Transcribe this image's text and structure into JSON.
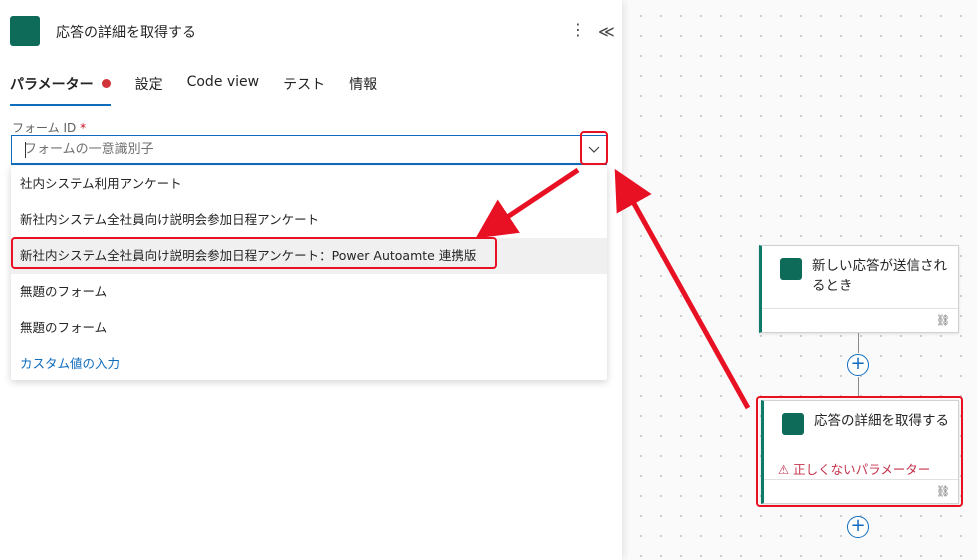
{
  "panel": {
    "title": "応答の詳細を取得する",
    "tabs": [
      {
        "label": "パラメーター",
        "active": true,
        "has_error": true
      },
      {
        "label": "設定"
      },
      {
        "label": "Code view"
      },
      {
        "label": "テスト"
      },
      {
        "label": "情報"
      }
    ],
    "more_icon": "⋮",
    "collapse_icon": "≪"
  },
  "form_field": {
    "label": "フォーム ID",
    "required_mark": "*",
    "placeholder": "フォームの一意識別子",
    "options": [
      "社内システム利用アンケート",
      "新社内システム全社員向け説明会参加日程アンケート",
      "新社内システム全社員向け説明会参加日程アンケート：Power Autoamte 連携版",
      "無題のフォーム",
      "無題のフォーム"
    ],
    "custom_value_label": "カスタム値の入力"
  },
  "canvas": {
    "trigger_title": "新しい応答が送信されるとき",
    "action_title": "応答の詳細を取得する",
    "action_error": "⚠ 正しくないパラメーター"
  },
  "colors": {
    "accent": "#0f6cbd",
    "brand": "#0e6b5a",
    "error_dot": "#d13438",
    "annotation": "#e81123"
  }
}
